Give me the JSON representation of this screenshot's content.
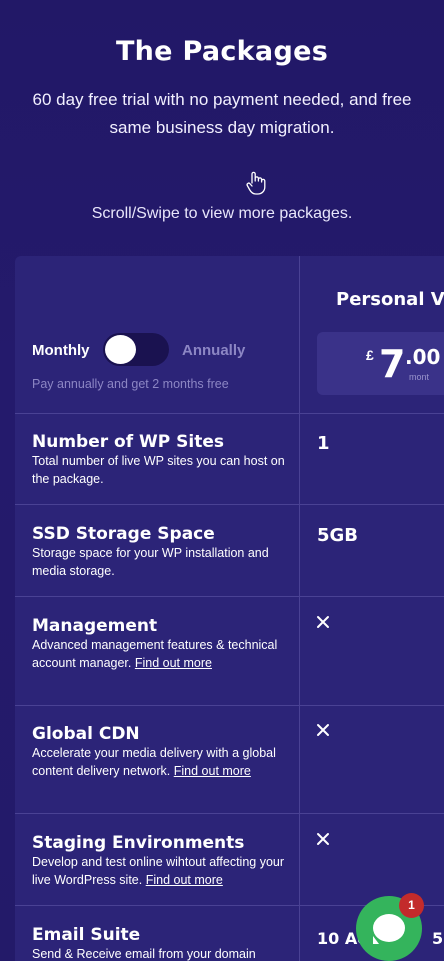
{
  "header": {
    "title": "The Packages",
    "subtitle": "60 day free trial with no payment needed, and free same business day migration.",
    "swipe_hint": "Scroll/Swipe to view more packages."
  },
  "icons": {
    "swipe": "hand-pointer-icon",
    "cross": "close-icon",
    "chat": "chat-icon"
  },
  "colors": {
    "background": "#221867",
    "table": "#2c2478",
    "chat": "#34b45c",
    "badge": "#c32b2b"
  },
  "billing": {
    "monthly_label": "Monthly",
    "annually_label": "Annually",
    "note": "Pay annually and get 2 months free"
  },
  "plan": {
    "name": "Personal V",
    "currency": "£",
    "price_int": "7",
    "price_dec": ".00",
    "period": "mont"
  },
  "features": [
    {
      "title": "Number of WP Sites",
      "desc": "Total number of live WP sites you can host on the package.",
      "value": "1"
    },
    {
      "title": "SSD Storage Space",
      "desc": "Storage space for your WP installation and media storage.",
      "value": "5GB"
    },
    {
      "title": "Management",
      "desc": "Advanced management features & technical account manager.",
      "link": "Find out more",
      "value": "✕"
    },
    {
      "title": "Global CDN",
      "desc": "Accelerate your media delivery with a global content delivery network.",
      "link": "Find out more",
      "value": "✕"
    },
    {
      "title": "Staging Environments",
      "desc": "Develop and test online wihtout affecting your live WordPress site.",
      "link": "Find out more",
      "value": "✕"
    },
    {
      "title": "Email Suite",
      "desc": "Send & Receive email from your domain",
      "value": "10 Ac",
      "value_tail": "5"
    }
  ],
  "chat": {
    "badge_count": "1"
  }
}
